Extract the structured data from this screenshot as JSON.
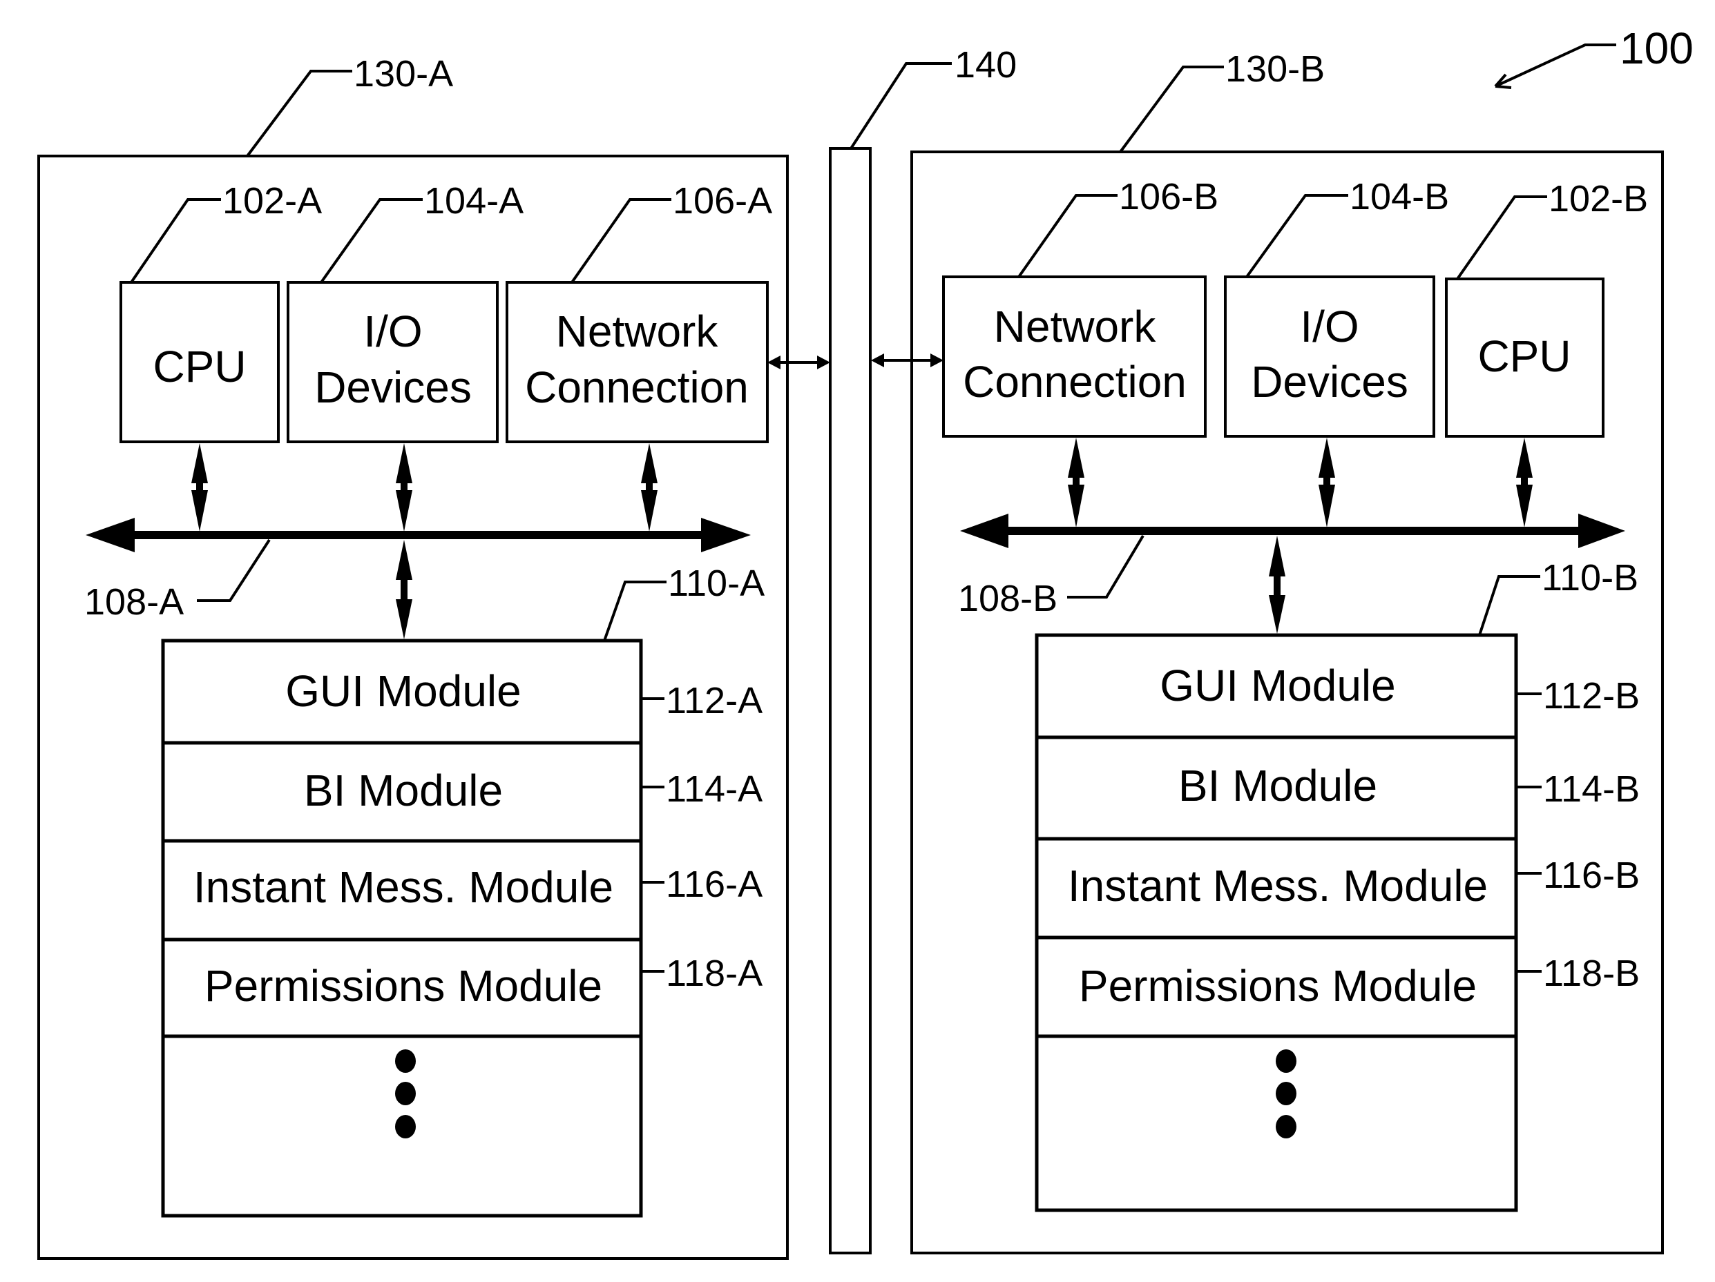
{
  "figure": {
    "ref": "100",
    "network": {
      "ref": "140"
    },
    "systems": [
      {
        "id": "A",
        "ref": "130-A",
        "components": [
          {
            "ref": "102-A",
            "lines": [
              "CPU"
            ]
          },
          {
            "ref": "104-A",
            "lines": [
              "I/O",
              "Devices"
            ]
          },
          {
            "ref": "106-A",
            "lines": [
              "Network",
              "Connection"
            ]
          }
        ],
        "bus_ref": "108-A",
        "memory_ref": "110-A",
        "modules": [
          {
            "ref": "112-A",
            "label": "GUI Module"
          },
          {
            "ref": "114-A",
            "label": "BI Module"
          },
          {
            "ref": "116-A",
            "label": "Instant Mess. Module"
          },
          {
            "ref": "118-A",
            "label": "Permissions Module"
          }
        ]
      },
      {
        "id": "B",
        "ref": "130-B",
        "components": [
          {
            "ref": "106-B",
            "lines": [
              "Network",
              "Connection"
            ]
          },
          {
            "ref": "104-B",
            "lines": [
              "I/O",
              "Devices"
            ]
          },
          {
            "ref": "102-B",
            "lines": [
              "CPU"
            ]
          }
        ],
        "bus_ref": "108-B",
        "memory_ref": "110-B",
        "modules": [
          {
            "ref": "112-B",
            "label": "GUI Module"
          },
          {
            "ref": "114-B",
            "label": "BI Module"
          },
          {
            "ref": "116-B",
            "label": "Instant Mess. Module"
          },
          {
            "ref": "118-B",
            "label": "Permissions Module"
          }
        ]
      }
    ]
  }
}
